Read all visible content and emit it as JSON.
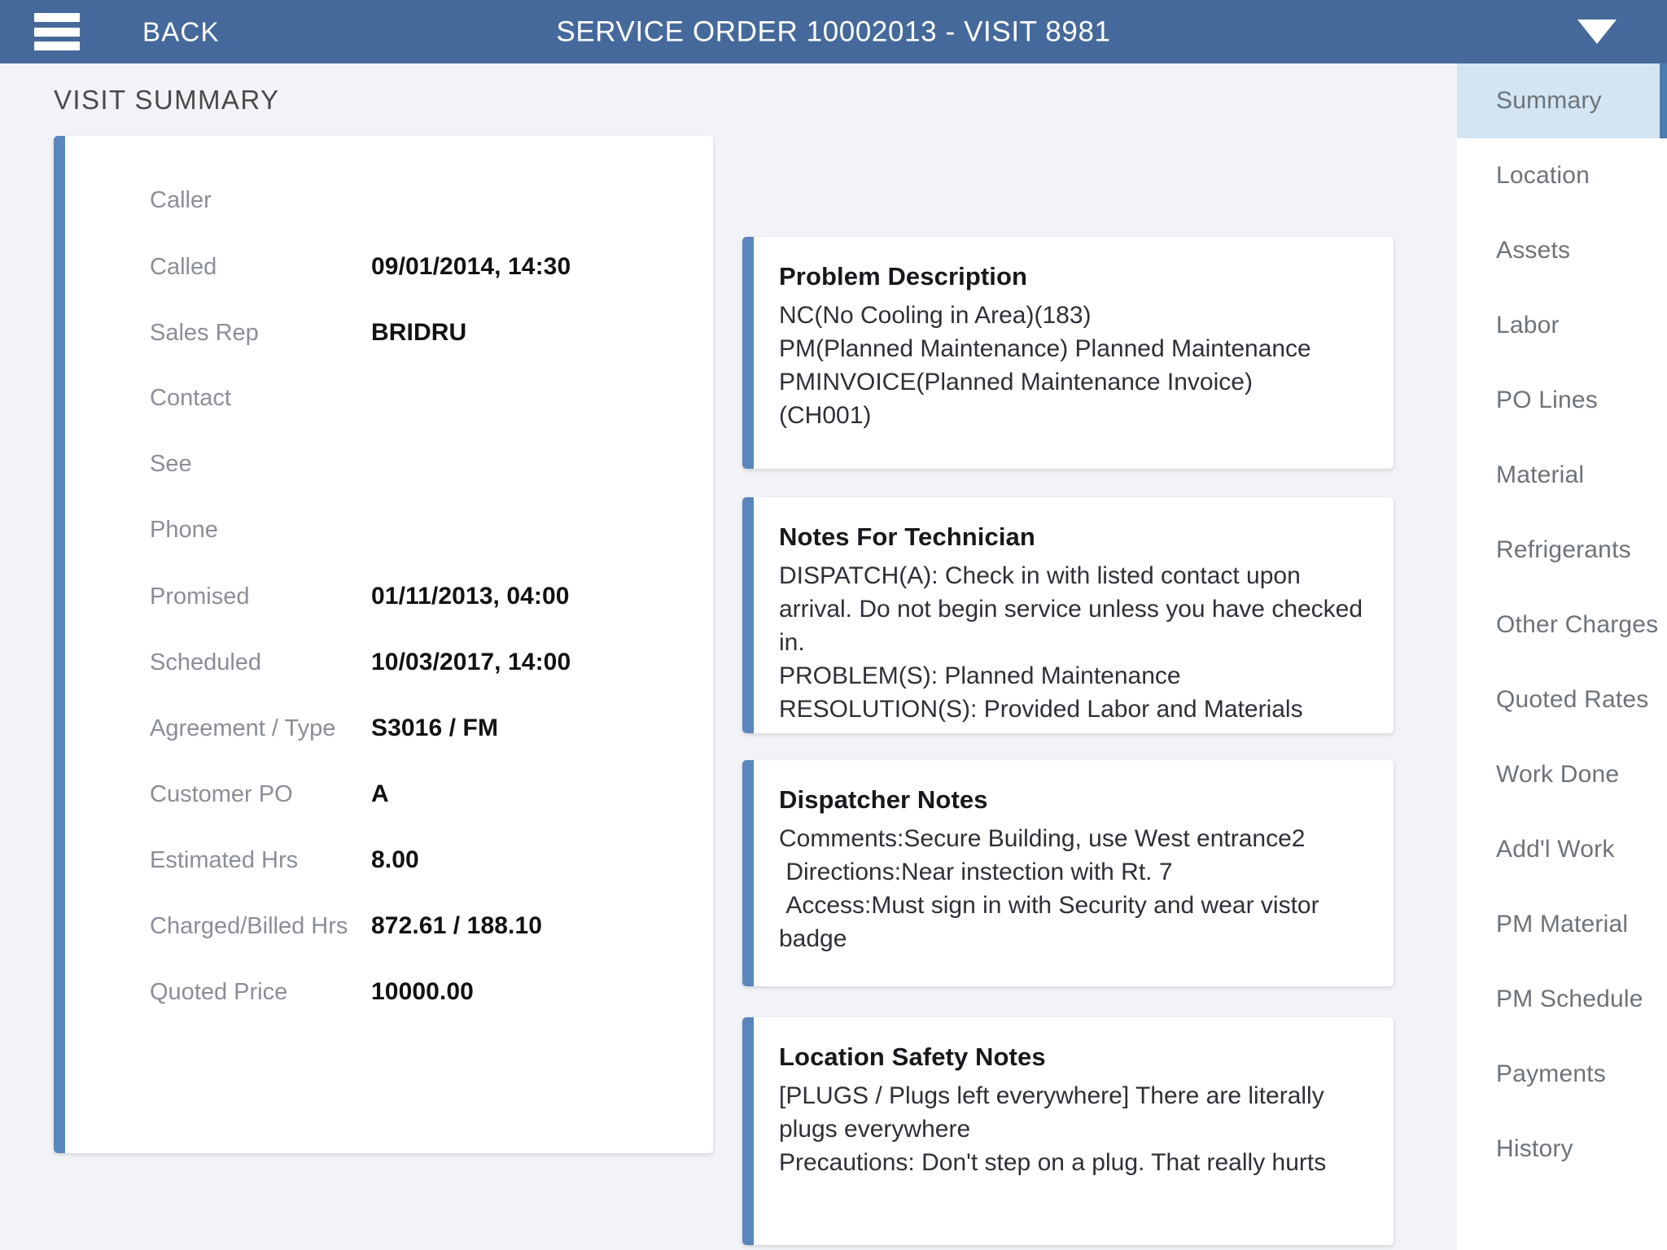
{
  "topbar": {
    "menu_icon": "hamburger-menu-icon",
    "back_label": "BACK",
    "title": "SERVICE ORDER 10002013 - VISIT 8981",
    "dropdown_icon": "chevron-down-icon",
    "background_color": "#45699b",
    "text_color": "#ffffff"
  },
  "page": {
    "title": "VISIT SUMMARY",
    "background_color": "#f1f3f7",
    "card_accent_color": "#5b86bd"
  },
  "summary": {
    "fields": [
      {
        "label": "Caller",
        "value": ""
      },
      {
        "label": "Called",
        "value": "09/01/2014, 14:30"
      },
      {
        "label": "Sales Rep",
        "value": "BRIDRU"
      },
      {
        "label": "Contact",
        "value": ""
      },
      {
        "label": "See",
        "value": ""
      },
      {
        "label": "Phone",
        "value": ""
      },
      {
        "label": "Promised",
        "value": "01/11/2013, 04:00"
      },
      {
        "label": "Scheduled",
        "value": "10/03/2017, 14:00"
      },
      {
        "label": "Agreement / Type",
        "value": "S3016 / FM"
      },
      {
        "label": "Customer PO",
        "value": "A"
      },
      {
        "label": "Estimated Hrs",
        "value": "8.00"
      },
      {
        "label": "Charged/Billed Hrs",
        "value": "872.61 / 188.10"
      },
      {
        "label": "Quoted Price",
        "value": "10000.00"
      }
    ]
  },
  "notes": {
    "problem": {
      "title": "Problem Description",
      "body": "NC(No Cooling in Area)(183)\nPM(Planned Maintenance) Planned Maintenance\nPMINVOICE(Planned Maintenance Invoice)\n(CH001)"
    },
    "technician": {
      "title": "Notes For Technician",
      "body": "DISPATCH(A): Check in with listed contact upon arrival. Do not begin service unless you have checked in.\nPROBLEM(S): Planned Maintenance\nRESOLUTION(S): Provided Labor and Materials"
    },
    "dispatcher": {
      "title": "Dispatcher Notes",
      "body": "Comments:Secure Building, use West entrance2\n Directions:Near instection with Rt. 7\n Access:Must sign in with Security and wear vistor badge"
    },
    "safety": {
      "title": "Location Safety Notes",
      "body": "[PLUGS / Plugs left everywhere] There are literally plugs everywhere\nPrecautions: Don't step on a plug. That really hurts"
    }
  },
  "sidebar": {
    "active_background_color": "#d3e5f3",
    "active_indicator_color": "#4a7cb0",
    "items": [
      {
        "label": "Summary",
        "active": true
      },
      {
        "label": "Location",
        "active": false
      },
      {
        "label": "Assets",
        "active": false
      },
      {
        "label": "Labor",
        "active": false
      },
      {
        "label": "PO Lines",
        "active": false
      },
      {
        "label": "Material",
        "active": false
      },
      {
        "label": "Refrigerants",
        "active": false
      },
      {
        "label": "Other Charges",
        "active": false
      },
      {
        "label": "Quoted Rates",
        "active": false
      },
      {
        "label": "Work Done",
        "active": false
      },
      {
        "label": "Add'l Work",
        "active": false
      },
      {
        "label": "PM Material",
        "active": false
      },
      {
        "label": "PM Schedule",
        "active": false
      },
      {
        "label": "Payments",
        "active": false
      },
      {
        "label": "History",
        "active": false
      }
    ]
  }
}
